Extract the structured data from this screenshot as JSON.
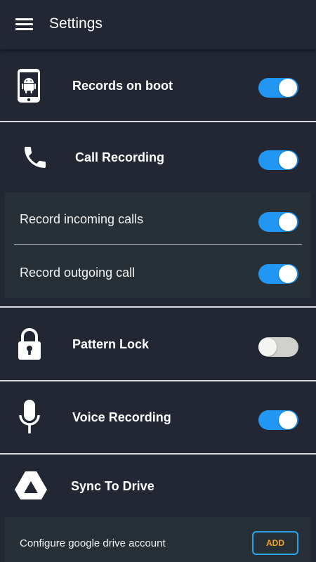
{
  "appbar": {
    "title": "Settings"
  },
  "rows": {
    "boot": {
      "label": "Records on boot",
      "toggle": true
    },
    "call": {
      "label": "Call Recording",
      "toggle": true
    },
    "incoming": {
      "label": "Record incoming calls",
      "toggle": true
    },
    "outgoing": {
      "label": "Record outgoing call",
      "toggle": true
    },
    "pattern": {
      "label": "Pattern Lock",
      "toggle": false
    },
    "voice": {
      "label": "Voice Recording",
      "toggle": true
    },
    "drive": {
      "label": "Sync To Drive"
    },
    "drive_account": {
      "label": "Configure google drive account",
      "button": "ADD"
    }
  },
  "colors": {
    "background": "#222733",
    "accent": "#2196f3",
    "button_text": "#f5a623",
    "panel": "#283037"
  },
  "icons": [
    "menu-icon",
    "android-phone-icon",
    "phone-icon",
    "padlock-icon",
    "microphone-icon",
    "google-drive-icon"
  ]
}
